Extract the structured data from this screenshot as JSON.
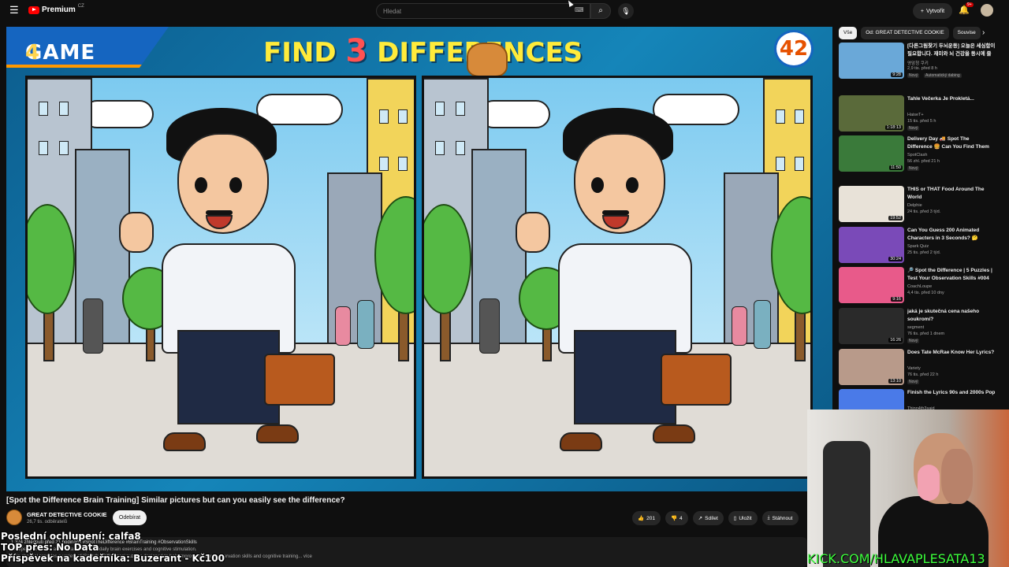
{
  "topbar": {
    "logo_text": "Premium",
    "logo_country": "CZ",
    "search_placeholder": "Hledat",
    "create_label": "Vytvořit",
    "notif_count": "9+"
  },
  "video": {
    "game_label": "GAME",
    "game_number": "4",
    "banner_pre": "FIND",
    "banner_num": "3",
    "banner_post": "DIFFERENCES",
    "counter": "42",
    "title": "[Spot the Difference Brain Training] Similar pictures but can you easily see the difference?"
  },
  "channel": {
    "name": "GREAT DETECTIVE COOKIE",
    "subscribers": "26,7 tis. odběratelů",
    "subscribe_label": "Odebírat"
  },
  "actions": {
    "likes": "201",
    "dislikes": "4",
    "share": "Sdílet",
    "save": "Uložit",
    "download": "Stáhnout"
  },
  "description": {
    "meta": "1 374 zhlédnutí  před 21 hodinami  #SpotTheDifference #BrainTraining #ObservationSkills",
    "line1": "Sharpen your focus and visual clarity with daily brain exercises and cognitive stimulation.",
    "line2": "This channel provides a variety of 'Spot the Difference' puzzles designed to help improve viewers' observation skills and cognitive training... více"
  },
  "overlay": {
    "line1": "Poslední ochlupení: calfa8",
    "line2": "TOP přes: No Data",
    "line3": "Příspěvek na kadeřníka: Buzerant - Kč100",
    "kick": "KICK.COM/HLAVAPLESATA13"
  },
  "chips": [
    "Vše",
    "Od: GREAT DETECTIVE COOKIE",
    "Souvise"
  ],
  "recommendations": [
    {
      "title": "[다른그림찾기 두뇌운동] 오늘은 세심함이 필요합니다. 재미와 뇌 건강을 동시에 즐길 수 있는 쪽쪽한 습...",
      "channel": "영암청 쿠키",
      "meta": "2,9 tis.  před 8 h",
      "badge": "Nový",
      "extra": "Automatický dabing",
      "duration": "9:28",
      "thumb_color": "#6aa8d8"
    },
    {
      "title": "Tahle Večerka Je Prokletá...",
      "channel": "HaiseT+",
      "meta": "15 tis.  před 5 h",
      "badge": "Nový",
      "duration": "1:18:13",
      "thumb_color": "#5a6a3a"
    },
    {
      "title": "Delivery Day 🚚 Spot The Difference 🍔 Can You Find Them Faster?",
      "channel": "SpotClash",
      "meta": "56 zhl.  před 21 h",
      "badge": "Nový",
      "duration": "11:50",
      "thumb_color": "#3a7a3a"
    },
    {
      "title": "THIS or THAT Food Around The World",
      "channel": "Delphie",
      "meta": "24 tis.  před 3 týd.",
      "badge": "",
      "duration": "19:52",
      "thumb_color": "#e8e2d8"
    },
    {
      "title": "Can You Guess 200 Animated Characters in 3 Seconds? 🤔",
      "channel": "Spark Quiz",
      "meta": "25 tis.  před 2 týd.",
      "badge": "",
      "duration": "30:24",
      "thumb_color": "#7a4ab8"
    },
    {
      "title": "🔎 Spot the Difference | 5 Puzzles | Test Your Observation Skills #004",
      "channel": "CoachLoupe",
      "meta": "4,4 tis.  před 10 dny",
      "badge": "",
      "duration": "9:16",
      "thumb_color": "#e85a8a"
    },
    {
      "title": "jaká je skutečná cena našeho soukromí?",
      "channel": "segment",
      "meta": "76 tis.  před 1 dnem",
      "badge": "Nový",
      "duration": "16:26",
      "thumb_color": "#2a2a2a"
    },
    {
      "title": "Does Tate McRae Know Her Lyrics?",
      "channel": "Variety",
      "meta": "76 tis.  před 22 h",
      "badge": "Nový",
      "duration": "13:10",
      "thumb_color": "#b89a8a"
    },
    {
      "title": "Finish the Lyrics 90s and 2000s Pop",
      "channel": "Thinn4th3said",
      "meta": "",
      "badge": "",
      "duration": "",
      "thumb_color": "#4a7ae8"
    }
  ]
}
